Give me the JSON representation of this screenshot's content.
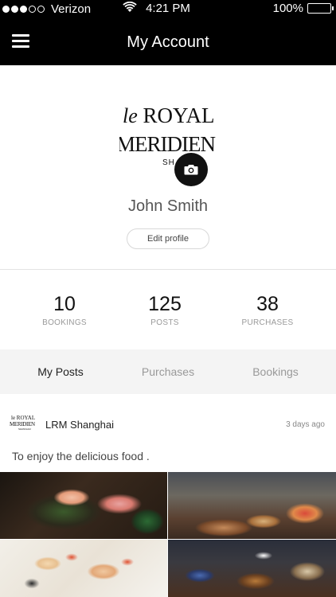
{
  "status_bar": {
    "carrier": "Verizon",
    "signal_full": 3,
    "signal_total": 5,
    "time": "4:21 PM",
    "battery": "100%",
    "battery_level": 1.0
  },
  "nav": {
    "title": "My Account",
    "menu_icon": "hamburger-menu-icon"
  },
  "profile": {
    "logo": {
      "line1_prefix": "le",
      "line1_word": "ROYAL",
      "line2": "MERIDIEN",
      "line3": "SH"
    },
    "camera_icon": "camera-icon",
    "name": "John Smith",
    "edit_label": "Edit profile"
  },
  "stats": [
    {
      "value": "10",
      "label": "BOOKINGS"
    },
    {
      "value": "125",
      "label": "POSTS"
    },
    {
      "value": "38",
      "label": "PURCHASES"
    }
  ],
  "tabs": [
    {
      "label": "My Posts",
      "active": true
    },
    {
      "label": "Purchases",
      "active": false
    },
    {
      "label": "Bookings",
      "active": false
    }
  ],
  "post": {
    "avatar": {
      "line1": "le ROYAL",
      "line2": "MERIDIEN",
      "line3": "SHANGHAI"
    },
    "author": "LRM Shanghai",
    "time": "3 days ago",
    "text": "To enjoy the delicious food ."
  }
}
